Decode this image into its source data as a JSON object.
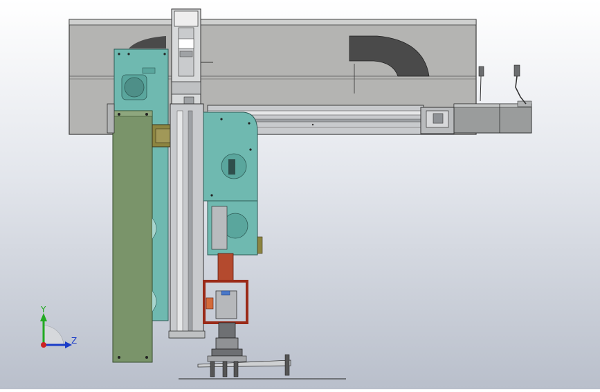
{
  "viewport": {
    "background_top": "#ffffff",
    "background_bottom": "#b9bfcb"
  },
  "model": {
    "part_colors": {
      "housing_grey": "#b4b4b2",
      "housing_edge": "#3c3c3c",
      "teal_plate": "#6fb9b0",
      "green_plate": "#7a946a",
      "olive_block": "#8c8440",
      "rail_grey": "#c8cacd",
      "motor_grey": "#9a9c9c",
      "red_frame": "#9a2a18",
      "dark_arc": "#4a4a4a"
    }
  },
  "triad": {
    "y_label": "Y",
    "z_label": "Z",
    "y_color": "#22aa22",
    "z_color": "#1a3cc8",
    "x_color": "#cc2222"
  }
}
